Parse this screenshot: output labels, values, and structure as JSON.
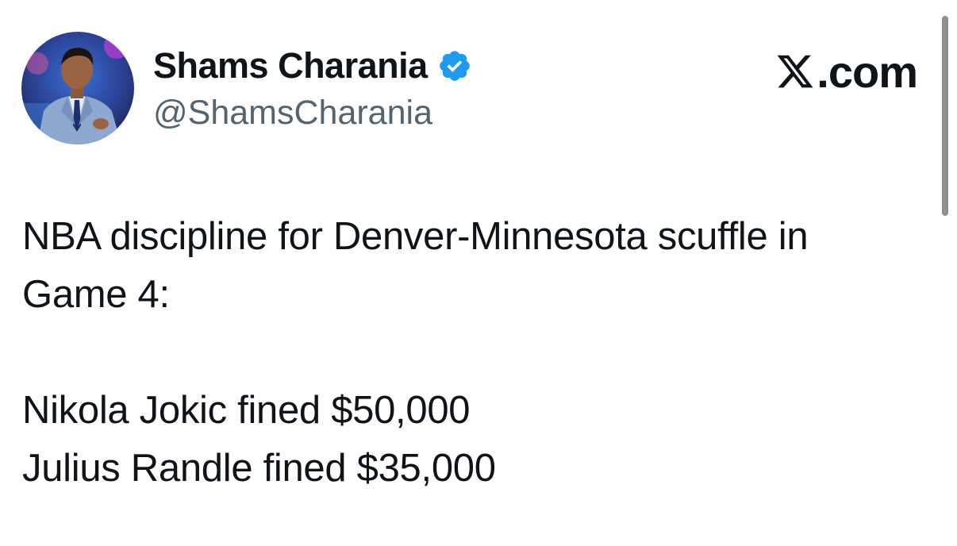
{
  "author": {
    "display_name": "Shams Charania",
    "handle": "@ShamsCharania",
    "verified": true,
    "avatar_icon": "profile-photo"
  },
  "brand": {
    "logo_icon": "x-logo-icon",
    "text": ".com"
  },
  "tweet": {
    "lines": [
      "NBA discipline for Denver-Minnesota scuffle in",
      "Game 4:",
      "",
      "Nikola Jokic fined $50,000",
      "Julius Randle fined $35,000"
    ]
  },
  "colors": {
    "verified_badge": "#1d9bf0",
    "handle_text": "#536471",
    "body_text": "#0f1419"
  }
}
